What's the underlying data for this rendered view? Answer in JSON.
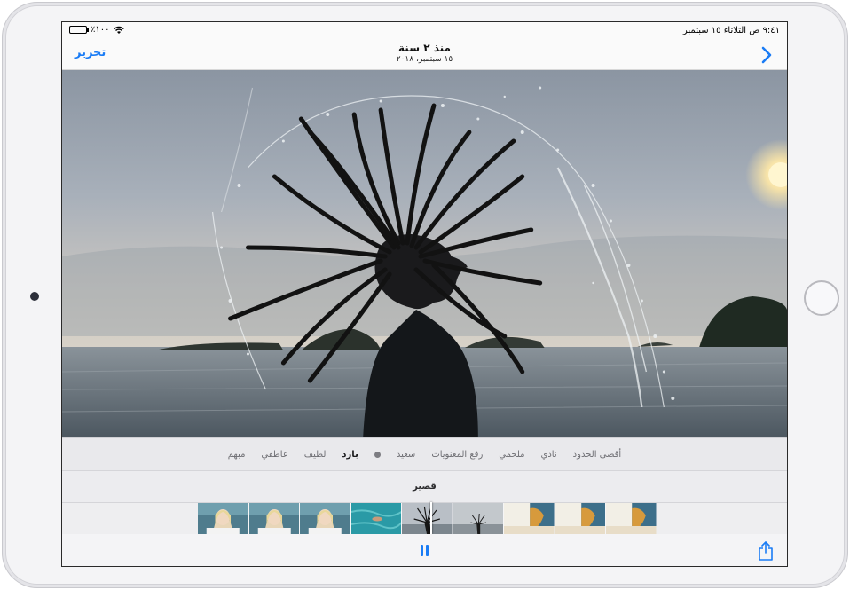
{
  "status_bar": {
    "time_date": "٩:٤١ ص  الثلاثاء ١٥ سبتمبر",
    "battery": "٪١٠٠",
    "wifi_icon": "wifi-icon",
    "battery_icon": "battery-icon"
  },
  "nav": {
    "title": "منذ ٢ سنة",
    "subtitle": "١٥ سبتمبر، ٢٠١٨",
    "edit_label": "تحرير",
    "back_icon": "chevron-right-icon"
  },
  "moods": {
    "items": [
      "أقصى الحدود",
      "نادي",
      "ملحمي",
      "رفع المعنويات",
      "سعيد",
      "بارد",
      "لطيف",
      "عاطفي",
      "مبهم"
    ],
    "selected_index": 5
  },
  "duration": {
    "label": "قصير"
  },
  "filmstrip": {
    "thumbnails": [
      "portrait",
      "portrait",
      "portrait",
      "swimmer",
      "hair-splash",
      "hair-splash-small",
      "dog-beach",
      "dog-beach",
      "dog-beach"
    ],
    "playhead_progress": 0.5
  },
  "toolbar": {
    "pause_icon": "pause-icon",
    "share_icon": "share-icon"
  },
  "colors": {
    "accent": "#1a7cf5",
    "sky": "#aeb7c1",
    "sea": "#6d7a84"
  }
}
